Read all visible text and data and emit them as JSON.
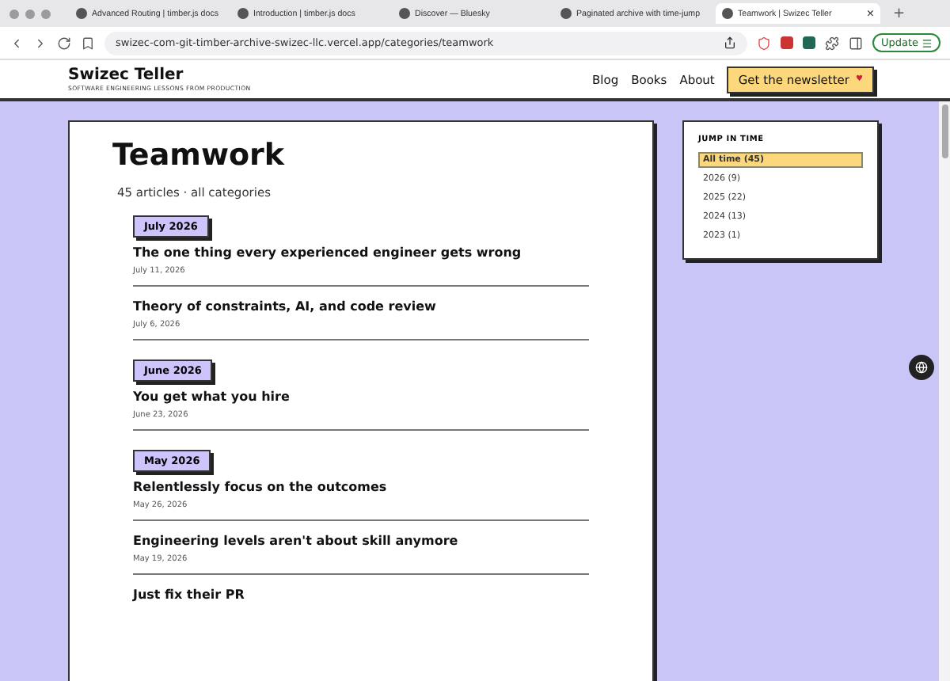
{
  "browser": {
    "tabs": [
      {
        "title": "Advanced Routing | timber.js docs",
        "selected": false
      },
      {
        "title": "Introduction | timber.js docs",
        "selected": false
      },
      {
        "title": "Discover — Bluesky",
        "selected": false
      },
      {
        "title": "Paginated archive with time-jump",
        "selected": false
      },
      {
        "title": "Teamwork | Swizec Teller",
        "selected": true
      }
    ],
    "new_tab": "+",
    "close": "×",
    "url": "swizec-com-git-timber-archive-swizec-llc.vercel.app/categories/teamwork",
    "update_button": "Update"
  },
  "site": {
    "name": "Swizec Teller",
    "tagline": "SOFTWARE ENGINEERING LESSONS FROM PRODUCTION",
    "nav": [
      "Blog",
      "Books",
      "About"
    ],
    "cta": "Get the newsletter",
    "cta_mark": "♥"
  },
  "category": {
    "title": "Teamwork",
    "summary": "45 articles · all categories",
    "groups": [
      {
        "month": "July 2026",
        "articles": [
          {
            "title": "The one thing every experienced engineer gets wrong",
            "date": "July 11, 2026"
          },
          {
            "title": "Theory of constraints, AI, and code review",
            "date": "July 6, 2026"
          }
        ]
      },
      {
        "month": "June 2026",
        "articles": [
          {
            "title": "You get what you hire",
            "date": "June 23, 2026"
          }
        ]
      },
      {
        "month": "May 2026",
        "articles": [
          {
            "title": "Relentlessly focus on the outcomes",
            "date": "May 26, 2026"
          },
          {
            "title": "Engineering levels aren't about skill anymore",
            "date": "May 19, 2026"
          },
          {
            "title": "Just fix their PR"
          }
        ]
      }
    ]
  },
  "jump": {
    "heading": "JUMP IN TIME",
    "items": [
      {
        "label": "All time (45)",
        "selected": true
      },
      {
        "label": "2026 (9)",
        "selected": false
      },
      {
        "label": "2025 (22)",
        "selected": false
      },
      {
        "label": "2024 (13)",
        "selected": false
      },
      {
        "label": "2023 (1)",
        "selected": false
      }
    ]
  }
}
